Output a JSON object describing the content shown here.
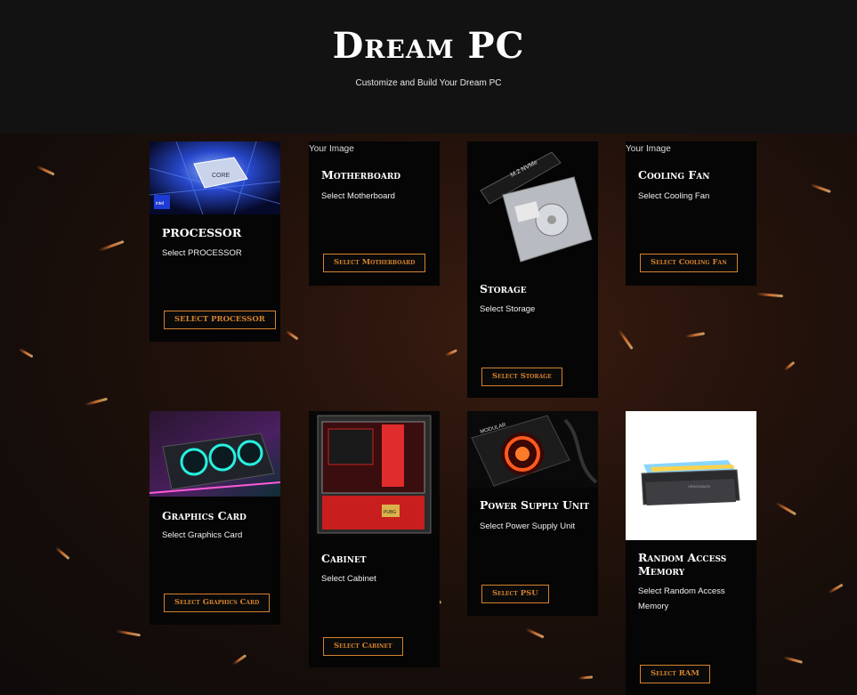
{
  "header": {
    "title": "Dream PC",
    "subtitle": "Customize and Build Your Dream PC"
  },
  "cards": [
    {
      "name": "PROCESSOR",
      "desc": "Select PROCESSOR",
      "button": "SELECT PROCESSOR",
      "image": "cpu-chip-image"
    },
    {
      "name": "Motherboard",
      "desc": "Select Motherboard",
      "button": "Select Motherboard",
      "image_alt": "Your Image"
    },
    {
      "name": "Storage",
      "desc": "Select Storage",
      "button": "Select Storage",
      "image": "storage-drives-image"
    },
    {
      "name": "Cooling Fan",
      "desc": "Select Cooling Fan",
      "button": "Select Cooling Fan",
      "image_alt": "Your Image"
    },
    {
      "name": "Graphics Card",
      "desc": "Select Graphics Card",
      "button": "Select Graphics Card",
      "image": "graphics-card-image"
    },
    {
      "name": "Cabinet",
      "desc": "Select Cabinet",
      "button": "Select Cabinet",
      "image": "pc-cabinet-image"
    },
    {
      "name": "Power Supply Unit",
      "desc": "Select Power Supply Unit",
      "button": "Select PSU",
      "image": "psu-image"
    },
    {
      "name": "Random Access Memory",
      "desc": "Select Random Access Memory",
      "button": "Select RAM",
      "image": "ram-sticks-image"
    }
  ],
  "colors": {
    "accent": "#d4822e",
    "card_bg": "#050505",
    "header_bg": "#121212"
  }
}
